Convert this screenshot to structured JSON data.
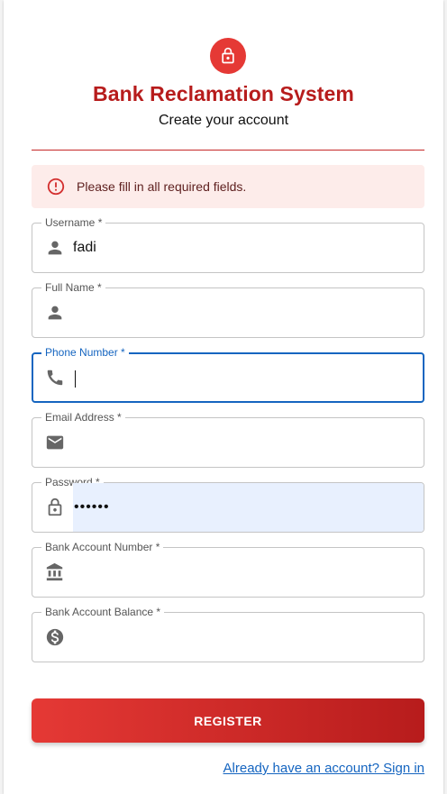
{
  "header": {
    "title": "Bank Reclamation System",
    "subtitle": "Create your account"
  },
  "alert": {
    "message": "Please fill in all required fields."
  },
  "fields": [
    {
      "label": "Username *",
      "value": "fadi",
      "icon": "person-icon"
    },
    {
      "label": "Full Name *",
      "value": "",
      "icon": "person-icon"
    },
    {
      "label": "Phone Number *",
      "value": "",
      "icon": "phone-icon",
      "focused": true
    },
    {
      "label": "Email Address *",
      "value": "",
      "icon": "email-icon"
    },
    {
      "label": "Password *",
      "value": "••••••",
      "icon": "lock-icon"
    },
    {
      "label": "Bank Account Number *",
      "value": "",
      "icon": "bank-icon"
    },
    {
      "label": "Bank Account Balance *",
      "value": "",
      "icon": "dollar-icon"
    }
  ],
  "actions": {
    "register_label": "REGISTER",
    "signin_link": "Already have an account? Sign in"
  },
  "colors": {
    "brand": "#b71c1c",
    "accent": "#e53935",
    "focus": "#1565c0",
    "alert_bg": "#fdecea"
  }
}
